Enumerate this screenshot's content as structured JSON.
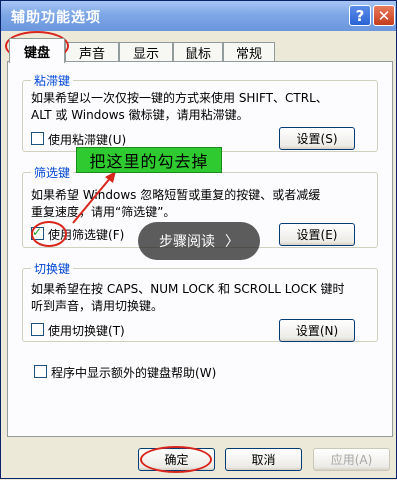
{
  "window": {
    "title": "辅助功能选项",
    "help_icon": "?",
    "close_icon": "✕"
  },
  "tabs": [
    "键盘",
    "声音",
    "显示",
    "鼠标",
    "常规"
  ],
  "sticky": {
    "title": "粘滞键",
    "desc_line1": "如果希望以一次仅按一键的方式来使用 SHIFT、CTRL、",
    "desc_line2": "ALT 或 Windows 徽标键，请用粘滞键。",
    "check_label": "使用粘滞键",
    "check_hotkey": "(U)",
    "checked": false,
    "settings_label": "设置",
    "settings_hotkey": "(S)"
  },
  "filter": {
    "title": "筛选键",
    "desc_line1": "如果希望 Windows 忽略短暂或重复的按键、或者减缓",
    "desc_line2": "重复速度，请用“筛选键”。",
    "check_label": "使用筛选键",
    "check_hotkey": "(F)",
    "checked": true,
    "settings_label": "设置",
    "settings_hotkey": "(E)"
  },
  "toggle": {
    "title": "切换键",
    "desc_line1": "如果希望在按 CAPS、NUM LOCK 和 SCROLL LOCK 键时",
    "desc_line2": "听到声音，请用切换键。",
    "check_label": "使用切换键",
    "check_hotkey": "(T)",
    "checked": false,
    "settings_label": "设置",
    "settings_hotkey": "(N)"
  },
  "extra": {
    "label": "程序中显示额外的键盘帮助",
    "hotkey": "(W)",
    "checked": false
  },
  "buttons": {
    "ok": "确定",
    "cancel": "取消",
    "apply": "应用(A)"
  },
  "annotation": {
    "callout": "把这里的勾去掉",
    "overlay": "步骤阅读",
    "overlay_arrow": "〉"
  },
  "colors": {
    "highlight_ring": "#d9261c",
    "callout_bg": "#2fca2f",
    "group_title": "#0046d5"
  }
}
